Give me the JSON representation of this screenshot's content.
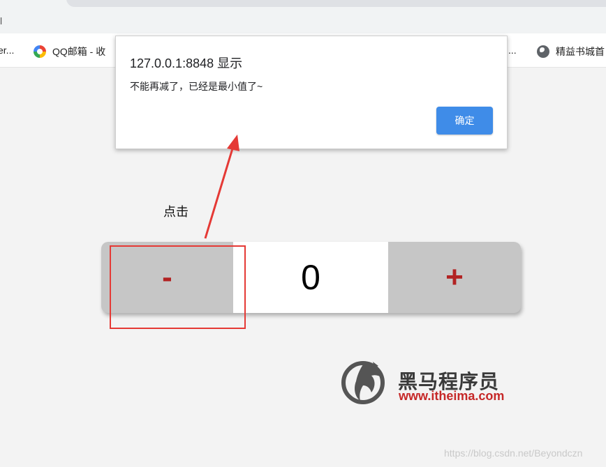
{
  "browser": {
    "url_fragment": "l",
    "bookmarks": [
      {
        "label": "er...",
        "icon": "none"
      },
      {
        "label": "QQ邮箱 - 收",
        "icon": "qq-mail-icon"
      },
      {
        "label": "...",
        "icon": "none"
      },
      {
        "label": "精益书城首",
        "icon": "globe-icon"
      }
    ]
  },
  "dialog": {
    "title": "127.0.0.1:8848 显示",
    "message": "不能再减了，已经是最小值了~",
    "ok_label": "确定"
  },
  "annotation": {
    "label": "点击",
    "color": "#e53935"
  },
  "counter": {
    "minus_label": "-",
    "value": "0",
    "plus_label": "+",
    "button_text_color": "#b22222",
    "button_background": "#c6c6c6"
  },
  "logo": {
    "name": "黑马程序员",
    "url": "www.itheima.com"
  },
  "watermark": "https://blog.csdn.net/Beyondczn"
}
